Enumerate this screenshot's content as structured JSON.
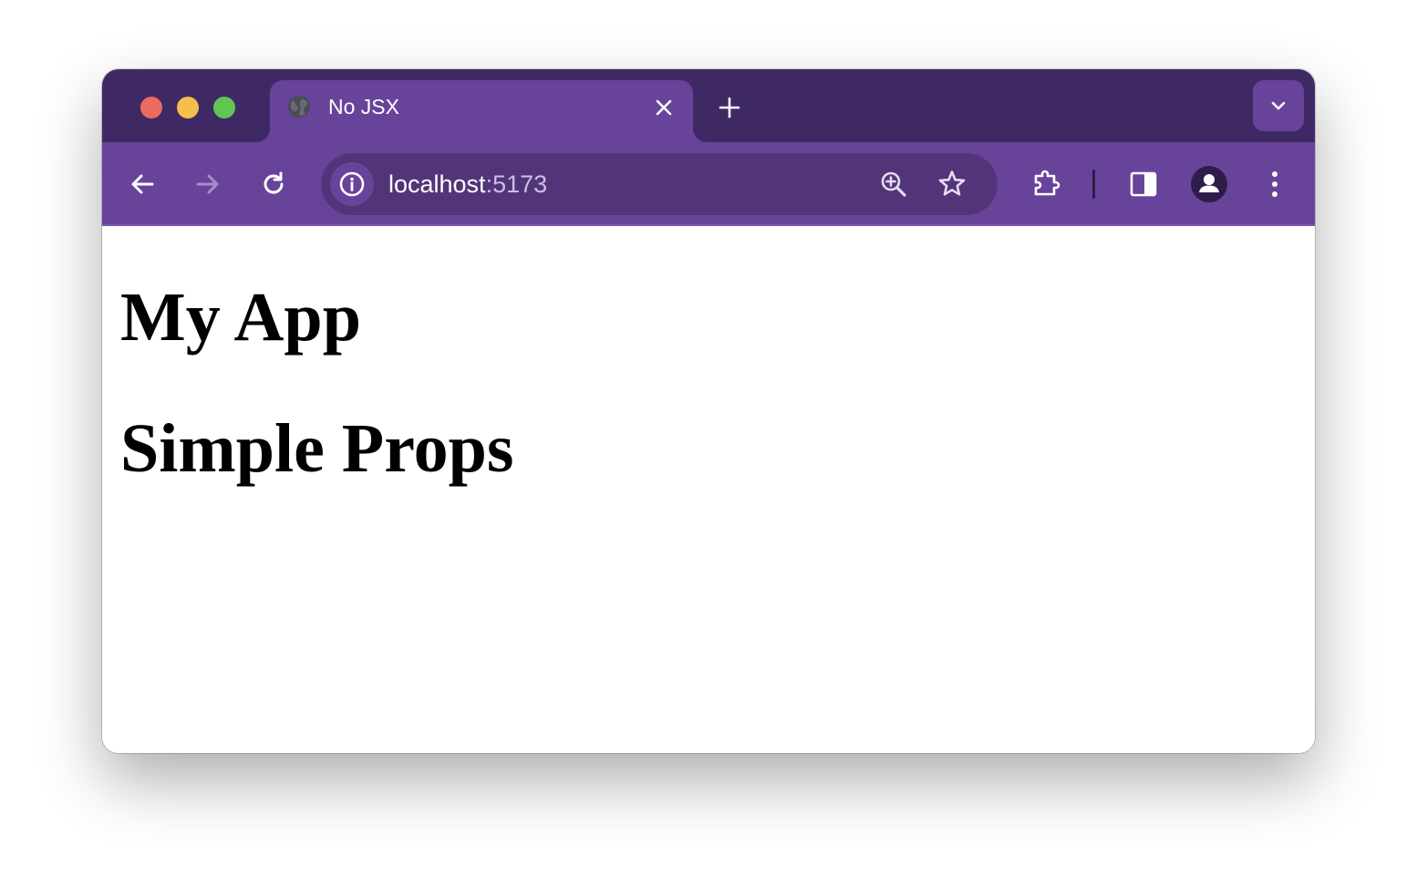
{
  "window": {
    "traffic_lights": [
      "close",
      "minimize",
      "zoom"
    ],
    "colors": {
      "tabstrip": "#3f2965",
      "toolbar": "#68439a",
      "omnibox": "#523578",
      "traffic_red": "#ed6a5e",
      "traffic_yellow": "#f5bf4f",
      "traffic_green": "#61c554"
    }
  },
  "tabs": [
    {
      "title": "No JSX",
      "favicon": "globe-icon",
      "active": true
    }
  ],
  "toolbar": {
    "back_icon": "arrow-left-icon",
    "forward_icon": "arrow-right-icon",
    "reload_icon": "reload-icon",
    "site_info_icon": "info-icon",
    "zoom_icon": "zoom-in-icon",
    "bookmark_icon": "star-icon",
    "extensions_icon": "puzzle-icon",
    "side_panel_icon": "side-panel-icon",
    "profile_icon": "avatar-icon",
    "menu_icon": "kebab-menu-icon"
  },
  "address_bar": {
    "host": "localhost",
    "port": ":5173"
  },
  "page": {
    "headings": [
      "My App",
      "Simple Props"
    ]
  }
}
